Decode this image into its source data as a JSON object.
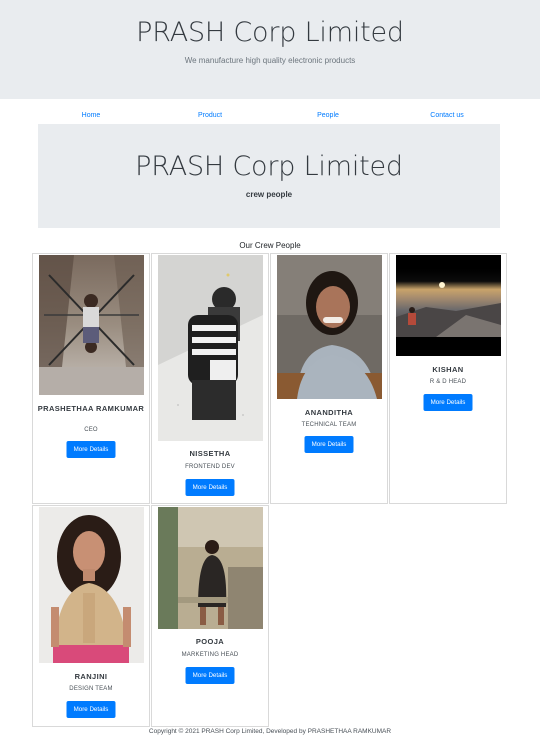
{
  "header": {
    "title": "PRASH Corp Limited",
    "tagline": "We manufacture high quality electronic products"
  },
  "nav": {
    "items": [
      "Home",
      "Product",
      "People",
      "Contact us"
    ]
  },
  "banner": {
    "title": "PRASH Corp Limited",
    "subtitle": "crew people"
  },
  "crew": {
    "heading": "Our Crew People",
    "button_label": "More Details",
    "members": [
      {
        "name": "PRASHETHAA RAMKUMAR",
        "role": "CEO"
      },
      {
        "name": "NISSETHA",
        "role": "FRONTEND DEV"
      },
      {
        "name": "ANANDITHA",
        "role": "TECHNICAL TEAM"
      },
      {
        "name": "KISHAN",
        "role": "R & D HEAD"
      },
      {
        "name": "RANJINI",
        "role": "DESIGN TEAM"
      },
      {
        "name": "POOJA",
        "role": "MARKETING HEAD"
      }
    ]
  },
  "footer": {
    "text": "Copyright © 2021 PRASH Corp Limited, Developed by PRASHETHAA RAMKUMAR"
  }
}
